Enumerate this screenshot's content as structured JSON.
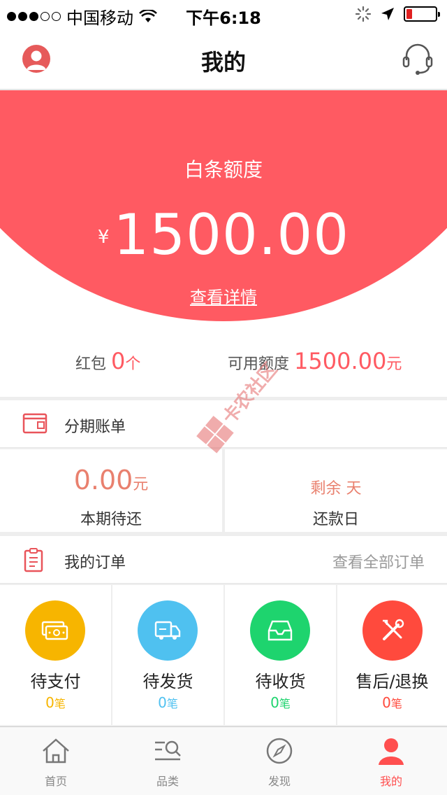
{
  "status_bar": {
    "carrier": "中国移动",
    "time": "下午6:18"
  },
  "nav": {
    "title": "我的"
  },
  "hero": {
    "label": "白条额度",
    "currency": "¥",
    "amount": "1500.00",
    "detail_link": "查看详情",
    "bg_color": "#ff5a62"
  },
  "stats": {
    "red_packet_label": "红包",
    "red_packet_value": "0",
    "red_packet_unit": "个",
    "available_label": "可用额度",
    "available_value": "1500.00",
    "available_unit": "元"
  },
  "installment": {
    "title": "分期账单",
    "due_amount": "0.00",
    "due_unit": "元",
    "due_caption": "本期待还",
    "remaining_text": "剩余 天",
    "repay_caption": "还款日"
  },
  "orders": {
    "title": "我的订单",
    "view_all": "查看全部订单",
    "items": [
      {
        "label": "待支付",
        "count": "0",
        "unit": "笔",
        "color": "#f7b500",
        "icon": "cash-icon"
      },
      {
        "label": "待发货",
        "count": "0",
        "unit": "笔",
        "color": "#4fc1f0",
        "icon": "truck-icon"
      },
      {
        "label": "待收货",
        "count": "0",
        "unit": "笔",
        "color": "#1ed46e",
        "icon": "inbox-icon"
      },
      {
        "label": "售后/退换",
        "count": "0",
        "unit": "笔",
        "color": "#ff4a3d",
        "icon": "tools-icon"
      }
    ]
  },
  "tabs": [
    {
      "label": "首页",
      "icon": "home-icon",
      "active": false
    },
    {
      "label": "品类",
      "icon": "category-search-icon",
      "active": false
    },
    {
      "label": "发现",
      "icon": "compass-icon",
      "active": false
    },
    {
      "label": "我的",
      "icon": "user-icon",
      "active": true
    }
  ],
  "watermark": {
    "text": "卡农社区"
  }
}
